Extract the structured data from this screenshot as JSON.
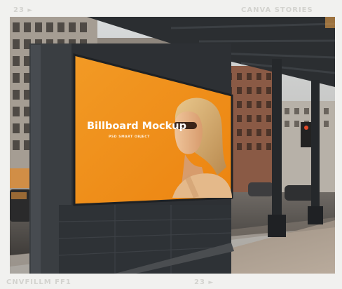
{
  "frame": {
    "top_left_number": "23",
    "top_right_brand": "CANVA STORIES",
    "bottom_left_code": "CNVFILLM FF1",
    "bottom_center_number": "23"
  },
  "billboard": {
    "title": "Billboard Mockup",
    "subtitle": "PSD SMART OBJECT"
  },
  "colors": {
    "ad_background": "#f28e16",
    "frame_text": "#d3d3cf",
    "canopy": "#2b2e31"
  }
}
